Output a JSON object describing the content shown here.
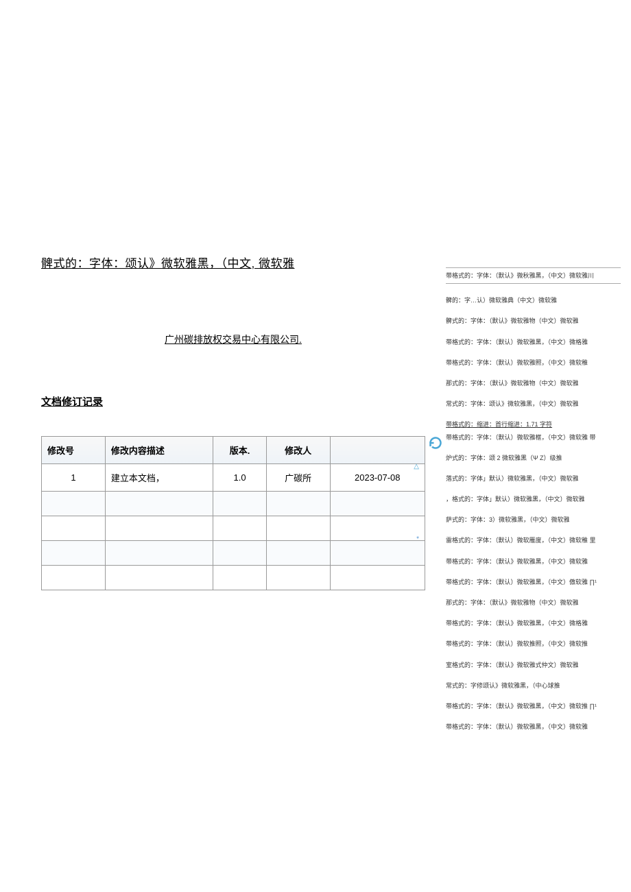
{
  "main": {
    "title": "髀式的：字体：颂认》微软雅黑，（中文, 微软雅",
    "company": "广州碳排放权交易中心有限公司.",
    "section": "文档修订记录"
  },
  "table": {
    "headers": {
      "num": "修改号",
      "desc": "修改内容描述",
      "ver": "版本.",
      "editor": "修改人",
      "date": ""
    },
    "rows": [
      {
        "num": "1",
        "desc": "建立本文档，",
        "ver": "1.0",
        "editor": "广碳所",
        "date": "2023-07-08"
      },
      {
        "num": "",
        "desc": "",
        "ver": "",
        "editor": "",
        "date": ""
      },
      {
        "num": "",
        "desc": "",
        "ver": "",
        "editor": "",
        "date": ""
      },
      {
        "num": "",
        "desc": "",
        "ver": "",
        "editor": "",
        "date": ""
      },
      {
        "num": "",
        "desc": "",
        "ver": "",
        "editor": "",
        "date": ""
      }
    ]
  },
  "sidebar": [
    "带格式的：字体：（默认》微秋雅黑，（中文）微软雅川",
    "髀的：字…认）微软雅典（中文）微软雅",
    "髀式的：字体：（默认》微软雅物（中文）微软雅",
    "带格式的：字体：（默认）微软雅黑，（中文）微格雅",
    "带格式的：字体：（默认）微软雅照，（中文）微软稚",
    "那式的：字体：（默认》微软雅物（中文）微软雅",
    "常式的：字体：颂认》微软雅黑，（中文）微软雅",
    "带格式的：缩进：首行缩进：1.71 字符",
    "带格式的：字体：（默认）微软雅框，（中文）微软雅 带",
    "炉式的：字体：颂 2 微软雅黑（Ψ Z）级推",
    "落式的：字体」默认）微软雅黑，（中文）微软雅",
    "，格式的：字体」默认）微软雅黑，（中文）微软雅",
    "      萨式的：字体：3）微软雅黑，（中文）微软雅",
    "雷格式的：字体：（默认）微软雁度，（中文）微软稚 里",
    "带格式的：字体：（默认》微软雅黑，（中文）微软雅",
    "带格式的：字体：（默认）微软雅黑，（中文）傲软雅 ∏¹",
    "那式的：字体：（默认》微软雅物（中文）微软雅",
    "带格式的：字体：（默认》微软雅黑，（中文）微格雅",
    "带格式的：字体：（默认）微软推照，（中文）微软推",
    "室格式的：字体：（默认》微软雅式仲文）微软雅",
    "常式的：字修颂认》微软雅黑，（中心球推",
    "带格式的：字体：（默认》微软雅黑，（中文）微软推 ∏¹",
    "带格式的：字体：（默认）微软雅黑，（中文）微软雅"
  ]
}
